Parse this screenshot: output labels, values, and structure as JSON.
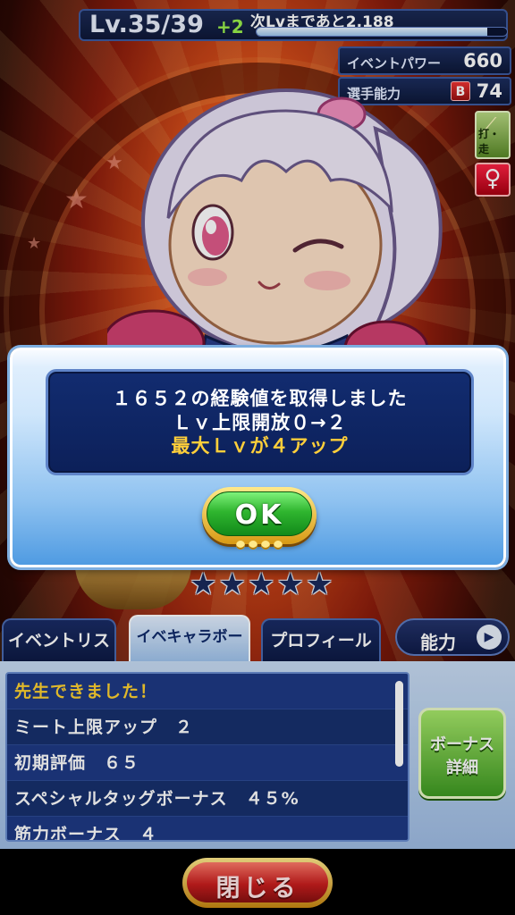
{
  "status": {
    "level_text": "Lv.35/39",
    "level_plus": "+2",
    "next_level_text": "次Lvまであと2,188",
    "exp_progress": 0.92
  },
  "stats": {
    "event_power_label": "イベントパワー",
    "event_power_value": "660",
    "player_ability_label": "選手能力",
    "player_ability_rank": "B",
    "player_ability_value": "74"
  },
  "badges": {
    "position_label": "打・走",
    "gender": "♀"
  },
  "dialog": {
    "line1": "１６５２の経験値を取得しました",
    "line2": "Ｌｖ上限開放０→２",
    "line3": "最大Ｌｖが４アップ",
    "ok_label": "OK",
    "accent_color": "#ffcf3a"
  },
  "rank_stars": {
    "count": 5,
    "glyph": "★"
  },
  "tabs": [
    {
      "label": "イベントリスト",
      "active": false
    },
    {
      "label": "イベキャラボーナス",
      "active": true
    },
    {
      "label": "プロフィール",
      "active": false
    }
  ],
  "ability_tab": {
    "label": "能力",
    "arrow": "▶"
  },
  "bonus_list": [
    {
      "text": "先生できました！",
      "highlight": true
    },
    {
      "text": "ミート上限アップ　２",
      "highlight": false
    },
    {
      "text": "初期評価　６５",
      "highlight": false
    },
    {
      "text": "スペシャルタッグボーナス　４５%",
      "highlight": false
    },
    {
      "text": "筋力ボーナス　４",
      "highlight": false
    }
  ],
  "bonus_detail": {
    "line1": "ボーナス",
    "line2": "詳細"
  },
  "close_button": {
    "label": "閉じる"
  }
}
